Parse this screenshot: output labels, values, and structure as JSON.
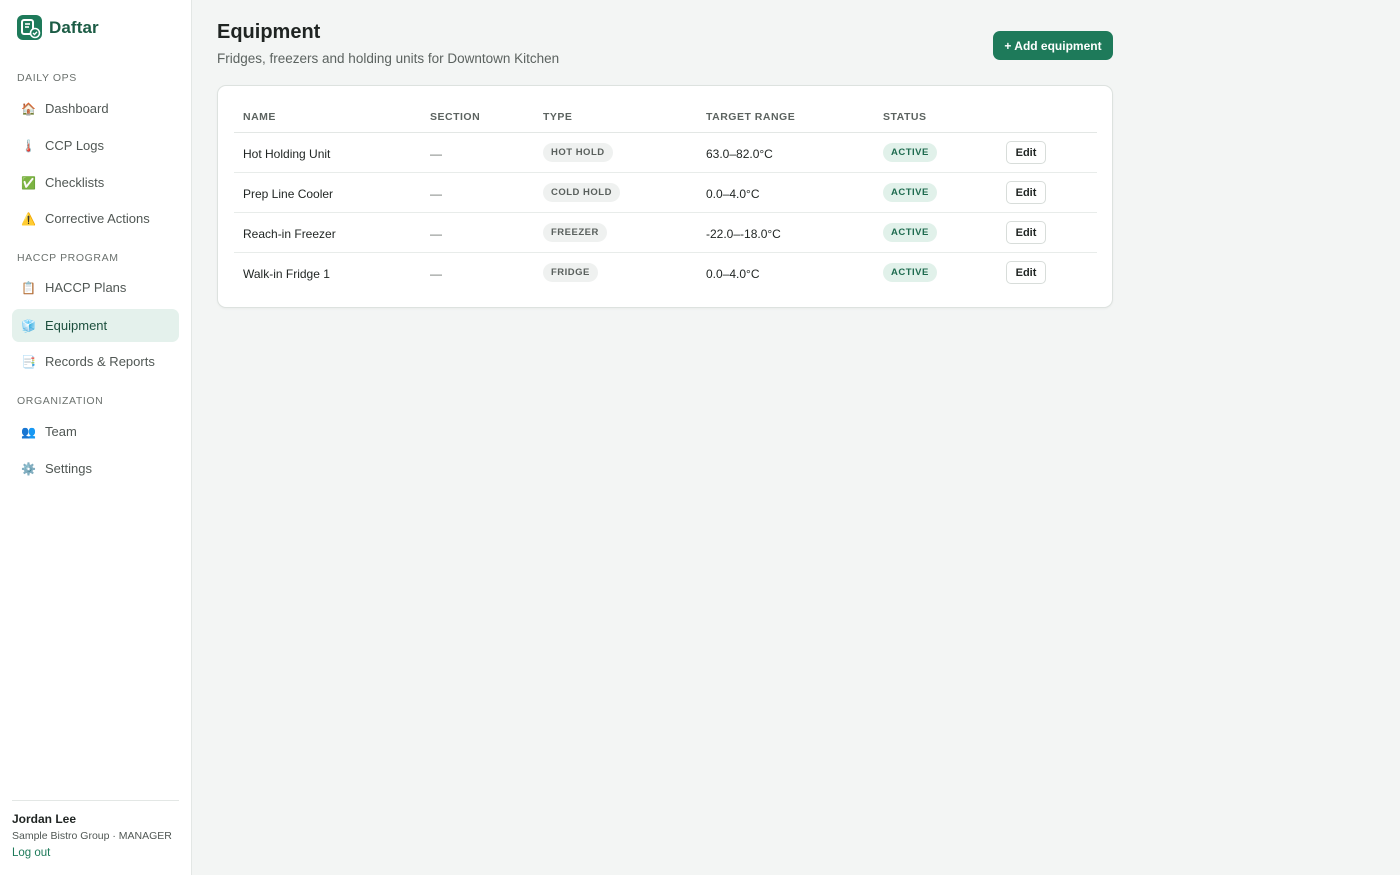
{
  "brand": {
    "name": "Daftar",
    "accent": "#1e7a5a"
  },
  "sidebar": {
    "sections": [
      {
        "label": "Daily Ops",
        "items": [
          {
            "label": "Dashboard",
            "icon": "house-icon",
            "glyph": "🏠"
          },
          {
            "label": "CCP Logs",
            "icon": "thermometer-icon",
            "glyph": "🌡️"
          },
          {
            "label": "Checklists",
            "icon": "check-box-icon",
            "glyph": "✅"
          },
          {
            "label": "Corrective Actions",
            "icon": "warning-icon",
            "glyph": "⚠️"
          }
        ]
      },
      {
        "label": "HACCP Program",
        "items": [
          {
            "label": "HACCP Plans",
            "icon": "clipboard-icon",
            "glyph": "📋"
          },
          {
            "label": "Equipment",
            "icon": "ice-cube-icon",
            "glyph": "🧊",
            "active": true
          },
          {
            "label": "Records & Reports",
            "icon": "bookmark-tabs-icon",
            "glyph": "📑"
          }
        ]
      },
      {
        "label": "Organization",
        "items": [
          {
            "label": "Team",
            "icon": "people-icon",
            "glyph": "👥"
          },
          {
            "label": "Settings",
            "icon": "gear-icon",
            "glyph": "⚙️"
          }
        ]
      }
    ]
  },
  "user": {
    "name": "Jordan Lee",
    "org_role": "Sample Bistro Group · MANAGER",
    "logout_label": "Log out"
  },
  "page": {
    "title": "Equipment",
    "subtitle": "Fridges, freezers and holding units for Downtown Kitchen",
    "add_button_label": "+ Add equipment"
  },
  "table": {
    "columns": [
      "Name",
      "Section",
      "Type",
      "Target Range",
      "Status"
    ],
    "rows": [
      {
        "name": "Hot Holding Unit",
        "section": "—",
        "type": "Hot Hold",
        "range": "63.0–82.0°C",
        "status": "Active",
        "edit_label": "Edit"
      },
      {
        "name": "Prep Line Cooler",
        "section": "—",
        "type": "Cold Hold",
        "range": "0.0–4.0°C",
        "status": "Active",
        "edit_label": "Edit"
      },
      {
        "name": "Reach-in Freezer",
        "section": "—",
        "type": "Freezer",
        "range": "-22.0–-18.0°C",
        "status": "Active",
        "edit_label": "Edit"
      },
      {
        "name": "Walk-in Fridge 1",
        "section": "—",
        "type": "Fridge",
        "range": "0.0–4.0°C",
        "status": "Active",
        "edit_label": "Edit"
      }
    ]
  }
}
